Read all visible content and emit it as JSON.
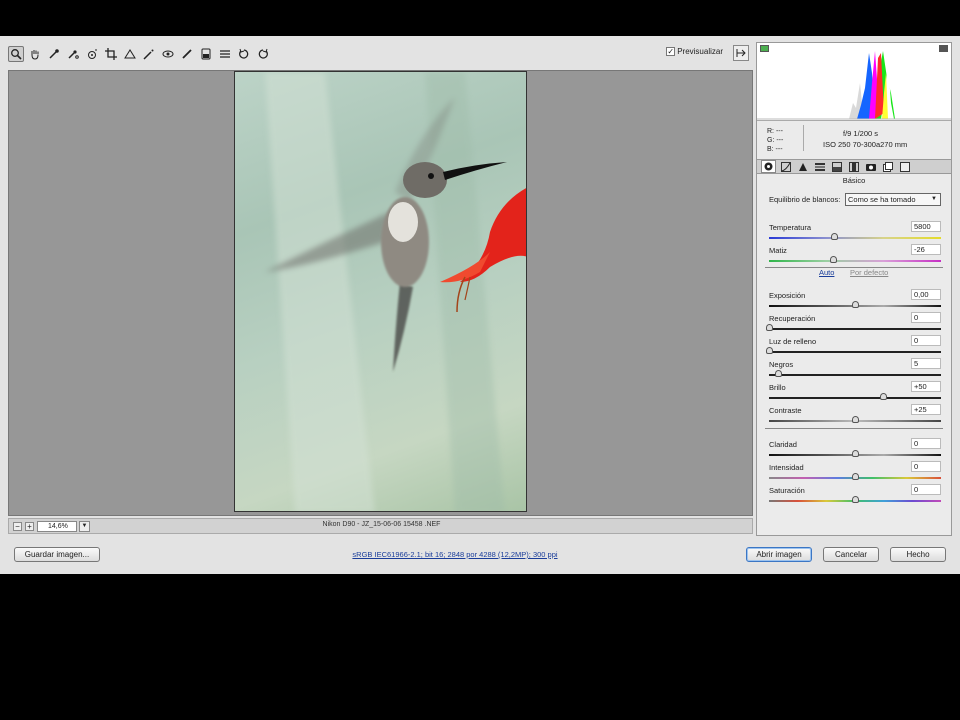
{
  "toolbar": {
    "tools": [
      {
        "name": "zoom-tool",
        "icon": "magnifier-icon"
      },
      {
        "name": "hand-tool",
        "icon": "hand-icon"
      },
      {
        "name": "white-balance-tool",
        "icon": "eyedropper-icon"
      },
      {
        "name": "color-sampler-tool",
        "icon": "color-sampler-icon"
      },
      {
        "name": "targeted-adjustment-tool",
        "icon": "target-icon"
      },
      {
        "name": "crop-tool",
        "icon": "crop-icon"
      },
      {
        "name": "straighten-tool",
        "icon": "straighten-icon"
      },
      {
        "name": "spot-removal-tool",
        "icon": "spot-removal-icon"
      },
      {
        "name": "red-eye-tool",
        "icon": "red-eye-icon"
      },
      {
        "name": "adjustment-brush-tool",
        "icon": "brush-icon"
      },
      {
        "name": "graduated-filter-tool",
        "icon": "gradient-icon"
      },
      {
        "name": "preferences-tool",
        "icon": "list-icon"
      },
      {
        "name": "rotate-left-tool",
        "icon": "rotate-ccw-icon"
      },
      {
        "name": "rotate-right-tool",
        "icon": "rotate-cw-icon"
      }
    ],
    "preview_label": "Previsualizar",
    "preview_checked": "✓"
  },
  "status": {
    "zoom_minus": "−",
    "zoom_plus": "+",
    "zoom": "14,6%",
    "zoom_arrow": "▼",
    "filename": "Nikon D90 -  JZ_15-06-06 15458 .NEF"
  },
  "readout": {
    "r": "R:   ---",
    "g": "G:   ---",
    "b": "B:   ---",
    "exif_line1": "f/9    1/200 s",
    "exif_line2": "ISO 250    70-300a270 mm"
  },
  "panel": {
    "title": "Básico",
    "wb_label": "Equilibrio de blancos:",
    "wb_value": "Como se ha tomado",
    "wb_arrow": "▼",
    "auto": "Auto",
    "default": "Por defecto",
    "sliders": [
      {
        "label": "Temperatura",
        "value": "5800",
        "level": 0.38,
        "track": "temp"
      },
      {
        "label": "Matiz",
        "value": "-26",
        "level": 0.37,
        "track": "tint"
      },
      {
        "label": "Exposición",
        "value": "0,00",
        "level": 0.5,
        "track": "gray"
      },
      {
        "label": "Recuperación",
        "value": "0",
        "level": 0.0,
        "track": "dark"
      },
      {
        "label": "Luz de relleno",
        "value": "0",
        "level": 0.0,
        "track": "dark"
      },
      {
        "label": "Negros",
        "value": "5",
        "level": 0.05,
        "track": "dark"
      },
      {
        "label": "Brillo",
        "value": "+50",
        "level": 0.66,
        "track": "dark"
      },
      {
        "label": "Contraste",
        "value": "+25",
        "level": 0.5,
        "track": "contrast"
      },
      {
        "label": "Claridad",
        "value": "0",
        "level": 0.5,
        "track": "gray"
      },
      {
        "label": "Intensidad",
        "value": "0",
        "level": 0.5,
        "track": "vib"
      },
      {
        "label": "Saturación",
        "value": "0",
        "level": 0.5,
        "track": "sat"
      }
    ]
  },
  "bottom": {
    "save": "Guardar imagen...",
    "info": "sRGB IEC61966-2.1; bit 16; 2848 por 4288 (12,2MP); 300 ppi",
    "open": "Abrir imagen",
    "cancel": "Cancelar",
    "done": "Hecho"
  },
  "colors": {
    "accent": "#3b76c4",
    "link": "#1a3d9a",
    "flower": "#e3231b"
  }
}
